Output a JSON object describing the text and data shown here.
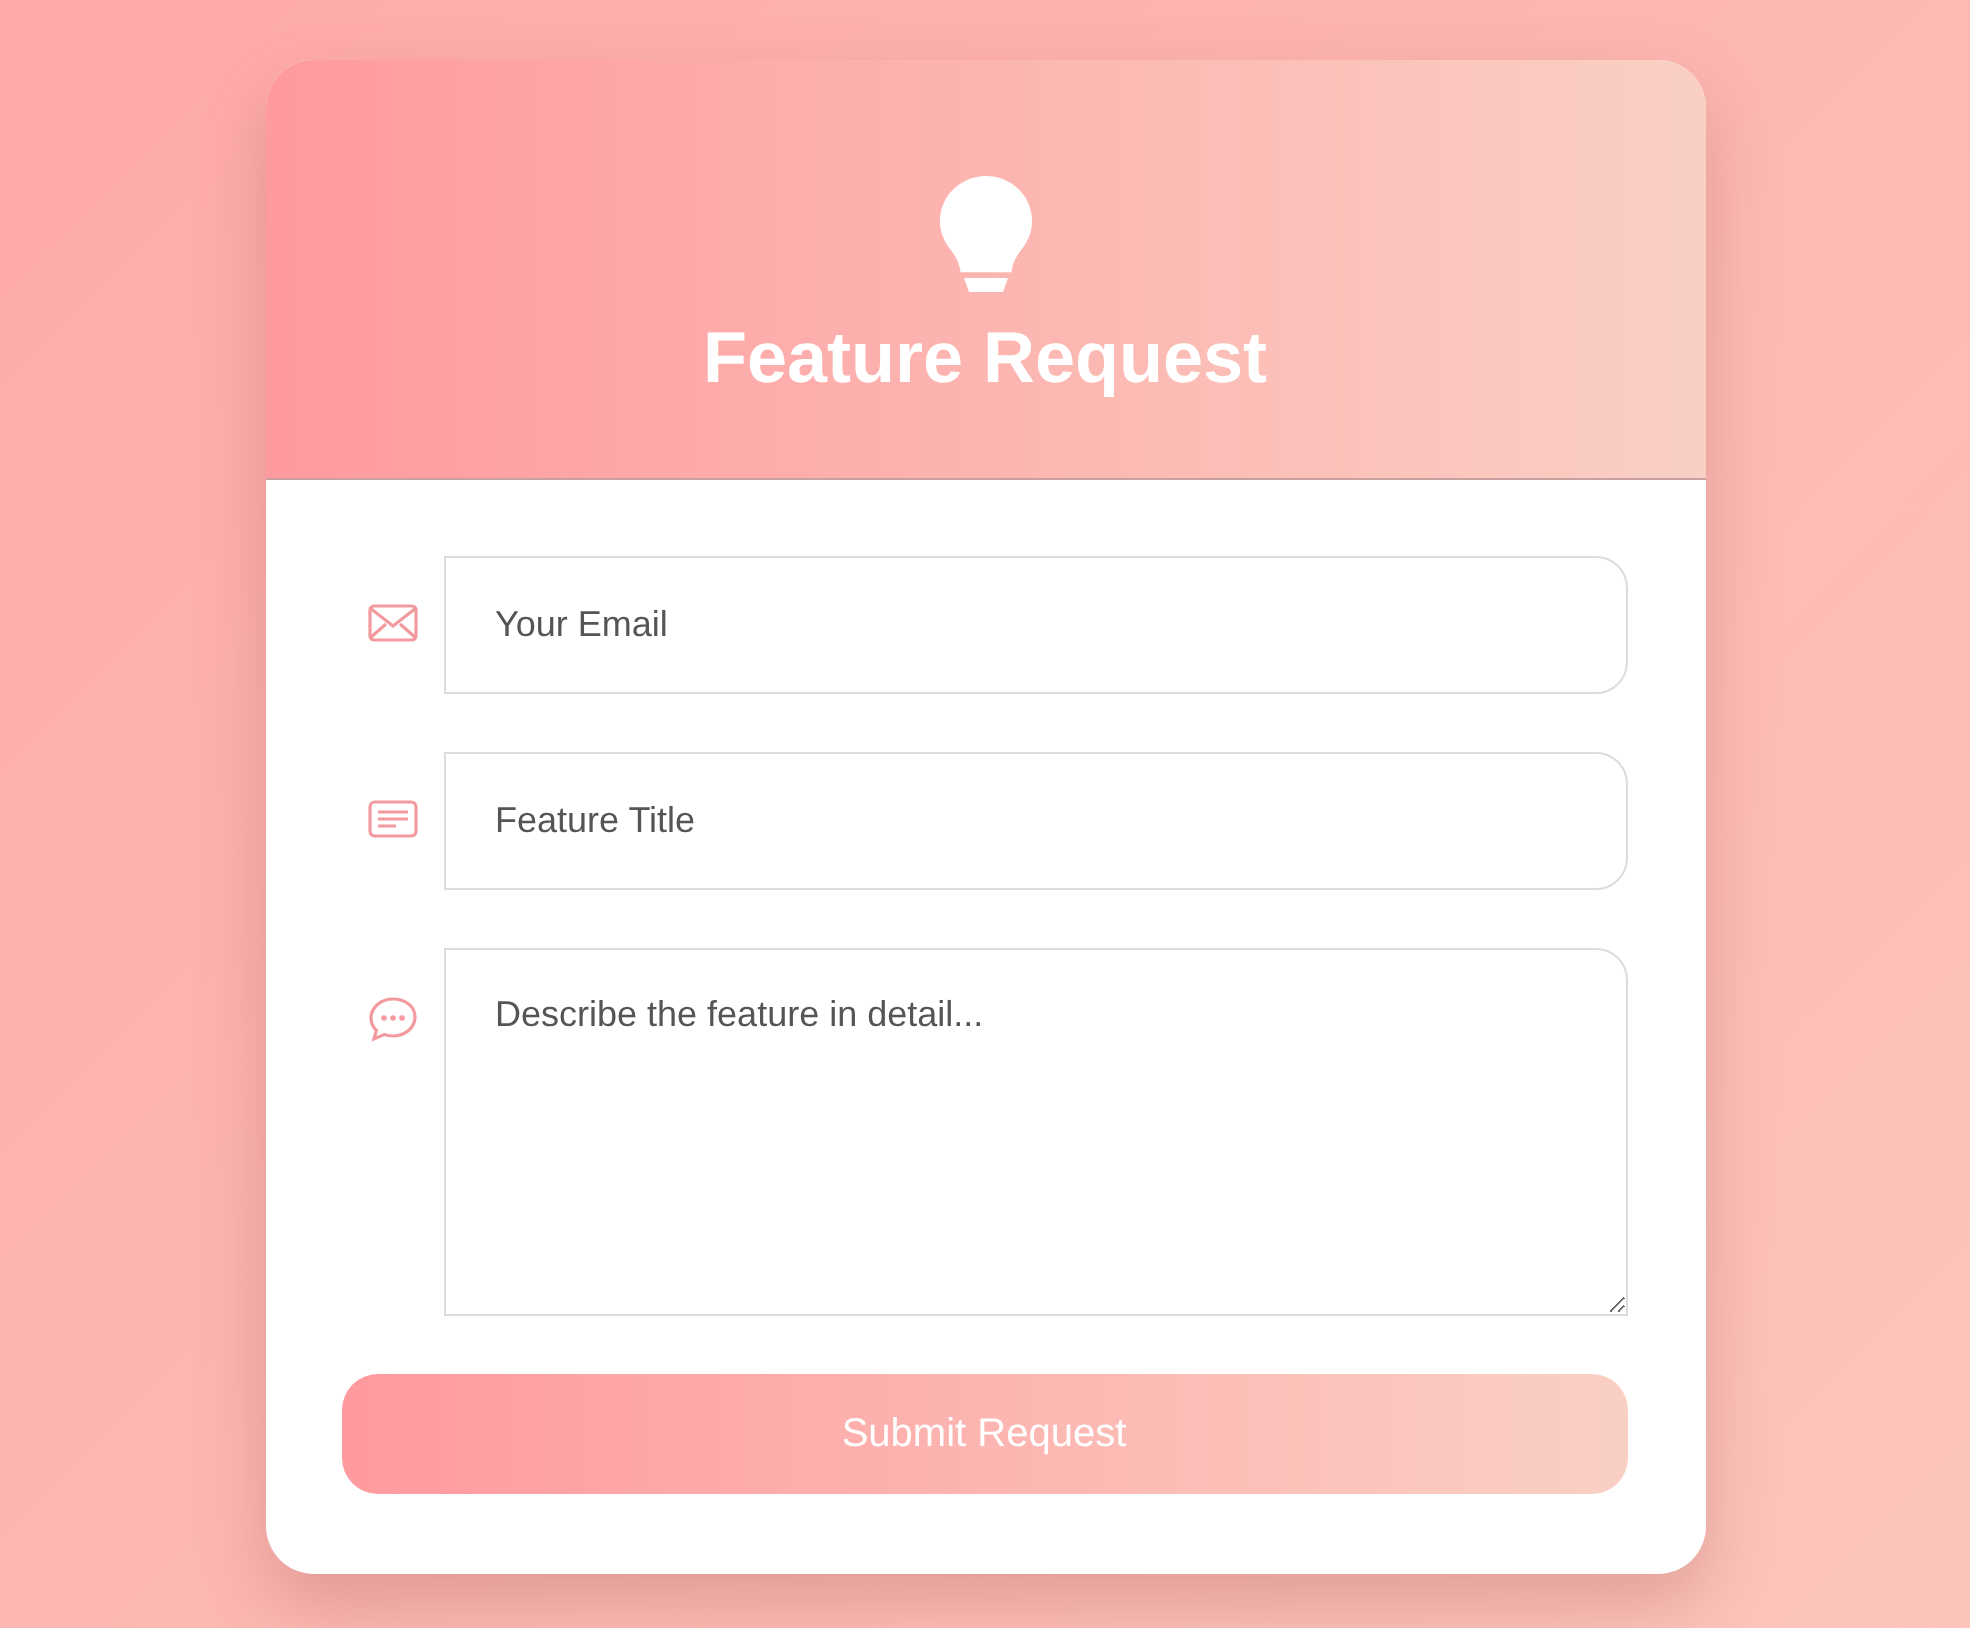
{
  "header": {
    "title": "Feature Request"
  },
  "fields": [
    {
      "kind": "email",
      "placeholder": "Your Email"
    },
    {
      "kind": "title",
      "placeholder": "Feature Title"
    },
    {
      "kind": "message",
      "placeholder": "Describe the feature in detail..."
    }
  ],
  "submit_button": {
    "label": "Submit Request"
  }
}
